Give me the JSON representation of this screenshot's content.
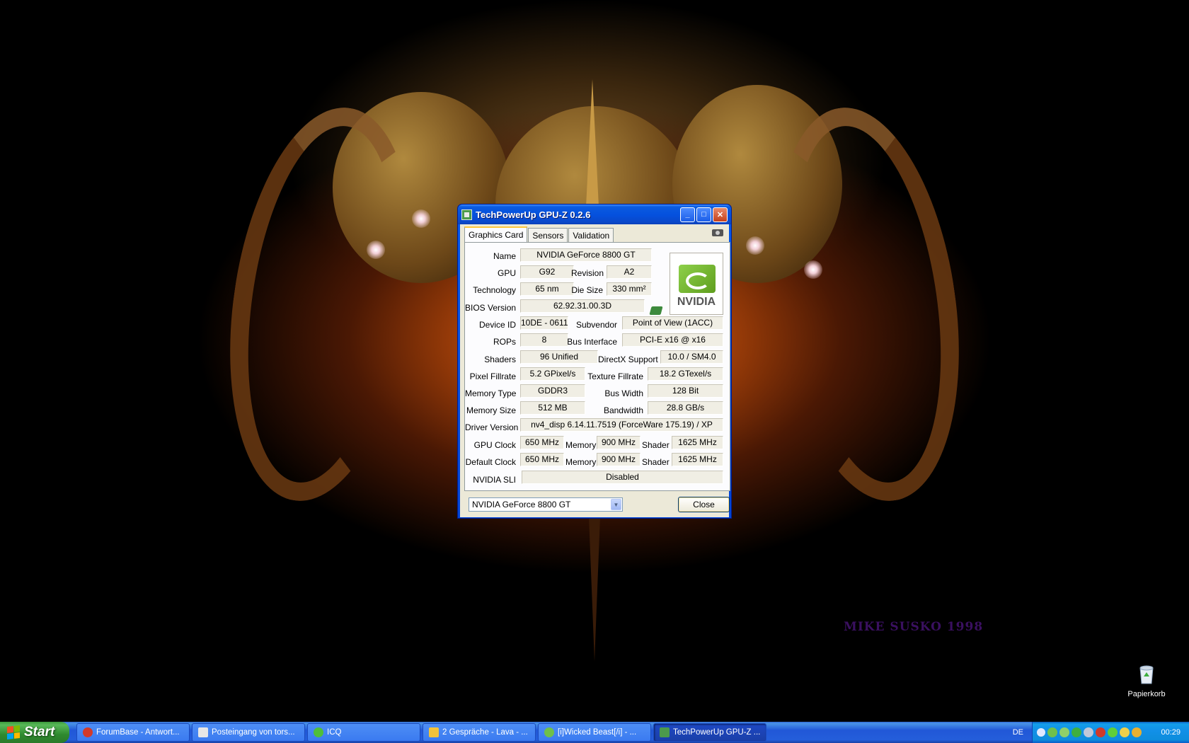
{
  "desktop": {
    "signature": "MIKE SUSKO 1998",
    "recycle_bin_label": "Papierkorb"
  },
  "window": {
    "title": "TechPowerUp GPU-Z 0.2.6",
    "tabs": [
      {
        "label": "Graphics Card",
        "active": true
      },
      {
        "label": "Sensors",
        "active": false
      },
      {
        "label": "Validation",
        "active": false
      }
    ],
    "labels": {
      "name": "Name",
      "gpu": "GPU",
      "revision": "Revision",
      "technology": "Technology",
      "die_size": "Die Size",
      "bios_version": "BIOS Version",
      "device_id": "Device ID",
      "subvendor": "Subvendor",
      "rops": "ROPs",
      "bus_interface": "Bus Interface",
      "shaders": "Shaders",
      "directx_support": "DirectX Support",
      "pixel_fillrate": "Pixel Fillrate",
      "texture_fillrate": "Texture Fillrate",
      "memory_type": "Memory Type",
      "bus_width": "Bus Width",
      "memory_size": "Memory Size",
      "bandwidth": "Bandwidth",
      "driver_version": "Driver Version",
      "gpu_clock": "GPU Clock",
      "memory": "Memory",
      "shader": "Shader",
      "default_clock": "Default Clock",
      "nvidia_sli": "NVIDIA SLI"
    },
    "values": {
      "name": "NVIDIA GeForce 8800 GT",
      "gpu": "G92",
      "revision": "A2",
      "technology": "65 nm",
      "die_size": "330 mm²",
      "bios_version": "62.92.31.00.3D",
      "device_id": "10DE - 0611",
      "subvendor": "Point of View (1ACC)",
      "rops": "8",
      "bus_interface": "PCI-E x16 @ x16",
      "shaders": "96 Unified",
      "directx_support": "10.0 / SM4.0",
      "pixel_fillrate": "5.2 GPixel/s",
      "texture_fillrate": "18.2 GTexel/s",
      "memory_type": "GDDR3",
      "bus_width": "128 Bit",
      "memory_size": "512 MB",
      "bandwidth": "28.8 GB/s",
      "driver_version": "nv4_disp 6.14.11.7519 (ForceWare 175.19) / XP",
      "gpu_clock": "650 MHz",
      "gpu_memory_clock": "900 MHz",
      "gpu_shader_clock": "1625 MHz",
      "default_clock": "650 MHz",
      "default_memory_clock": "900 MHz",
      "default_shader_clock": "1625 MHz",
      "nvidia_sli": "Disabled"
    },
    "vendor_logo_text": "NVIDIA",
    "gpu_select_value": "NVIDIA GeForce 8800 GT",
    "close_label": "Close"
  },
  "taskbar": {
    "start_label": "Start",
    "tasks": [
      {
        "label": "ForumBase - Antwort...",
        "icon_color": "#d23a2a",
        "active": false
      },
      {
        "label": "Posteingang von tors...",
        "icon_color": "#e6e6e6",
        "active": false
      },
      {
        "label": "ICQ",
        "icon_color": "#4fbf3a",
        "active": false
      },
      {
        "label": "2 Gespräche - Lava - ...",
        "icon_color": "#f2c23a",
        "active": false
      },
      {
        "label": "[i]Wicked Beast[/i] - ...",
        "icon_color": "#6fc04a",
        "active": false
      },
      {
        "label": "TechPowerUp GPU-Z ...",
        "icon_color": "#4c9a4c",
        "active": true
      }
    ],
    "language": "DE",
    "clock": "00:29"
  }
}
